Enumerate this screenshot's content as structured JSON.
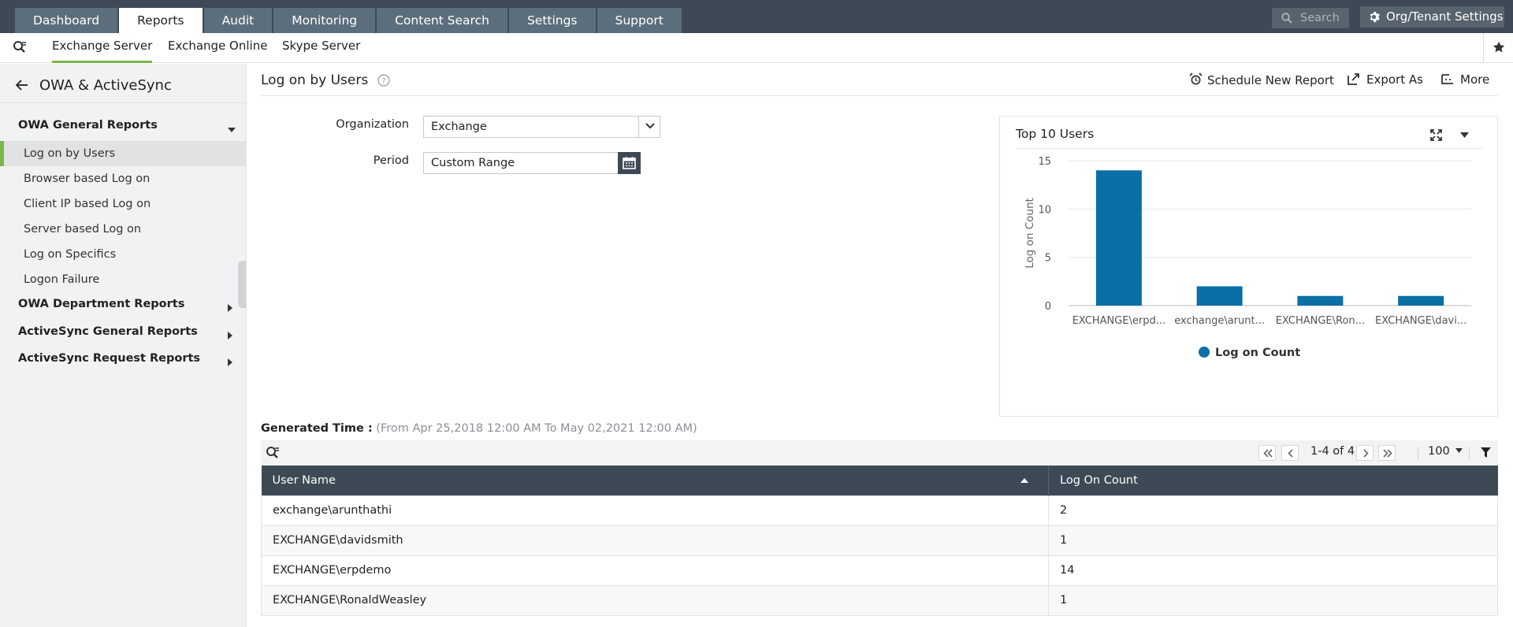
{
  "topbar": {
    "tabs": [
      {
        "label": "Dashboard"
      },
      {
        "label": "Reports"
      },
      {
        "label": "Audit"
      },
      {
        "label": "Monitoring"
      },
      {
        "label": "Content Search"
      },
      {
        "label": "Settings"
      },
      {
        "label": "Support"
      }
    ],
    "active_tab": "Reports",
    "search_placeholder": "Search",
    "org_settings_label": "Org/Tenant Settings"
  },
  "subnav": {
    "tabs": [
      "Exchange Server",
      "Exchange Online",
      "Skype Server"
    ],
    "active": "Exchange Server"
  },
  "sidebar": {
    "title": "OWA & ActiveSync",
    "groups": [
      {
        "label": "OWA General Reports",
        "expanded": true,
        "items": [
          "Log on by Users",
          "Browser based Log on",
          "Client IP based Log on",
          "Server based Log on",
          "Log on Specifics",
          "Logon Failure"
        ]
      },
      {
        "label": "OWA Department Reports",
        "expanded": false
      },
      {
        "label": "ActiveSync General Reports",
        "expanded": false
      },
      {
        "label": "ActiveSync Request Reports",
        "expanded": false
      }
    ],
    "active_item": "Log on by Users"
  },
  "report": {
    "title": "Log on by Users",
    "actions": {
      "schedule": "Schedule New Report",
      "export": "Export As",
      "more": "More"
    },
    "filters": {
      "organization_label": "Organization",
      "organization_value": "Exchange",
      "period_label": "Period",
      "period_value": "Custom Range"
    },
    "generated_label": "Generated Time :",
    "generated_range": "(From Apr 25,2018 12:00 AM To May 02,2021 12:00 AM)"
  },
  "chart_data": {
    "type": "bar",
    "title": "Top 10 Users",
    "categories": [
      "EXCHANGE\\erpd...",
      "exchange\\arunt...",
      "EXCHANGE\\Ron...",
      "EXCHANGE\\davi..."
    ],
    "series": [
      {
        "name": "Log on Count",
        "values": [
          14,
          2,
          1,
          1
        ]
      }
    ],
    "ylabel": "Log on Count",
    "ylim": [
      0,
      15
    ],
    "yticks": [
      0,
      5,
      10,
      15
    ],
    "grid": true,
    "legend": "bottom-center",
    "color": "#0a6fa5"
  },
  "grid": {
    "pagination": {
      "range": "1-4 of 4",
      "page_size": "100"
    },
    "columns": [
      "User Name",
      "Log On Count"
    ],
    "rows": [
      {
        "user": "exchange\\arunthathi",
        "count": "2"
      },
      {
        "user": "EXCHANGE\\davidsmith",
        "count": "1"
      },
      {
        "user": "EXCHANGE\\erpdemo",
        "count": "14"
      },
      {
        "user": "EXCHANGE\\RonaldWeasley",
        "count": "1"
      }
    ]
  },
  "colors": {
    "topbar": "#3d4a55",
    "tab": "#5c6e7b",
    "accent_green": "#7ab648",
    "bar": "#0a6fa5"
  }
}
